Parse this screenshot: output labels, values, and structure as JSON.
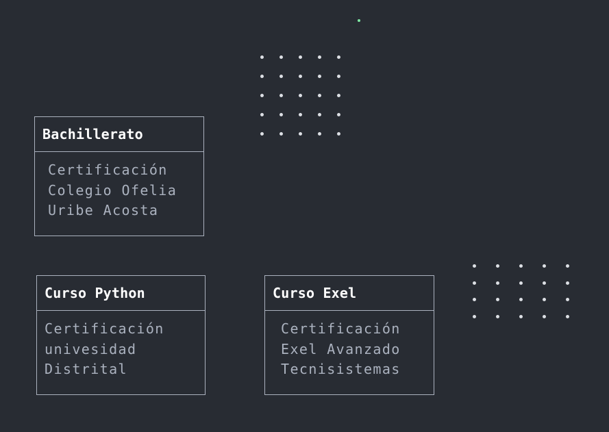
{
  "accent_color": "#7ee8a3",
  "border_color": "#abb2bf",
  "background_color": "#282c33",
  "cards": [
    {
      "title": "Bachillerato",
      "lines": [
        "Certificación",
        "Colegio Ofelia",
        "Uribe Acosta"
      ]
    },
    {
      "title": "Curso Python",
      "lines": [
        "Certificación",
        "univesidad",
        "Distrital"
      ]
    },
    {
      "title": "Curso Exel",
      "lines": [
        "Certificación",
        "Exel Avanzado",
        "Tecnisistemas"
      ]
    }
  ]
}
